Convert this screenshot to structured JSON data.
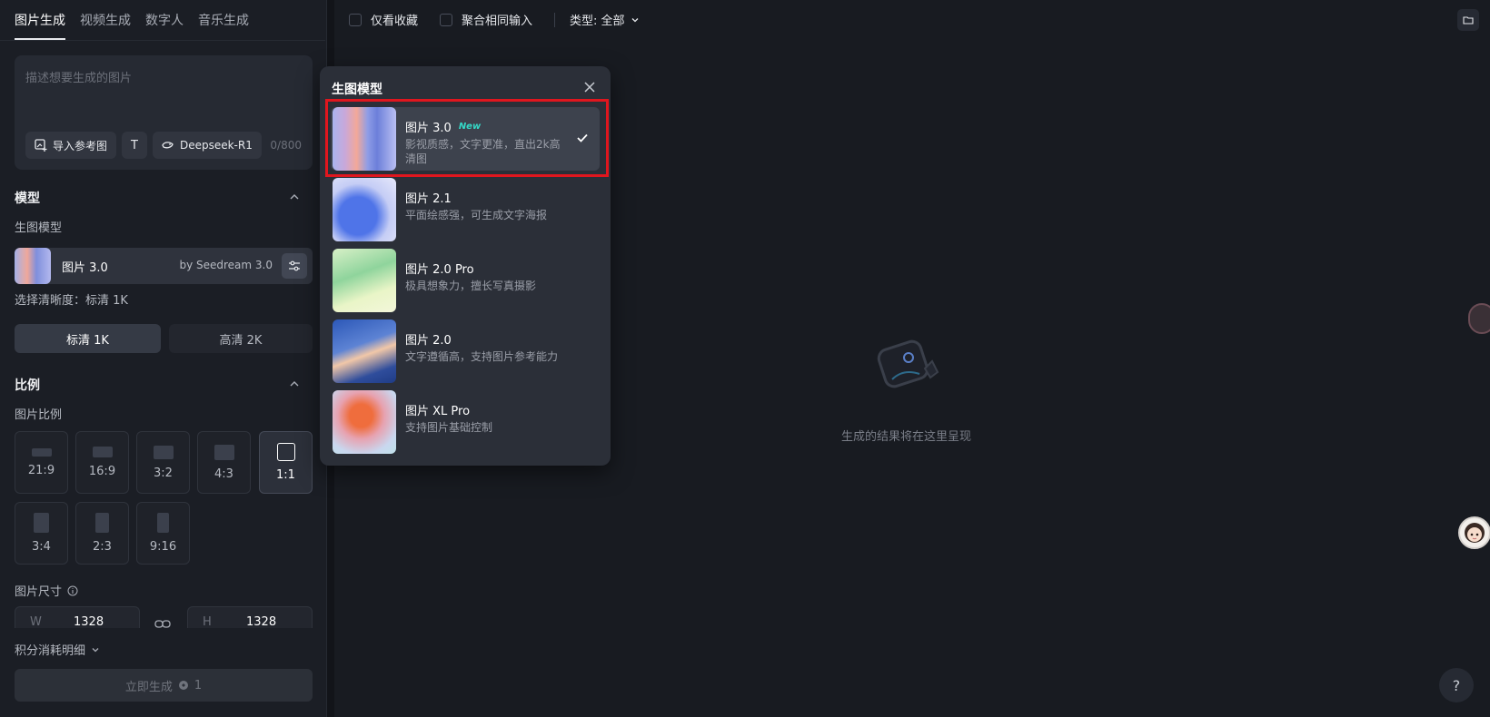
{
  "tabs": [
    "图片生成",
    "视频生成",
    "数字人",
    "音乐生成"
  ],
  "prompt": {
    "placeholder": "描述想要生成的图片",
    "import_label": "导入参考图",
    "text_tool_label": "T",
    "deepseek_label": "Deepseek-R1",
    "counter": "0/800"
  },
  "model_section": {
    "title": "模型",
    "sub_label": "生图模型",
    "current_name": "图片 3.0",
    "current_by": "by Seedream 3.0"
  },
  "resolution": {
    "label": "选择清晰度：标清 1K",
    "options": [
      "标清 1K",
      "高清 2K"
    ],
    "selected": "标清 1K"
  },
  "ratio_section": {
    "title": "比例",
    "sub_label": "图片比例",
    "options": [
      "21:9",
      "16:9",
      "3:2",
      "4:3",
      "1:1",
      "3:4",
      "2:3",
      "9:16"
    ],
    "selected": "1:1"
  },
  "size": {
    "label": "图片尺寸",
    "w_label": "W",
    "w_value": "1328",
    "h_label": "H",
    "h_value": "1328"
  },
  "footer": {
    "credits_label": "积分消耗明细",
    "generate_label": "立即生成",
    "generate_cost": "1"
  },
  "topbar": {
    "favorites_label": "仅看收藏",
    "merge_label": "聚合相同输入",
    "type_label": "类型: 全部"
  },
  "empty_state": {
    "text": "生成的结果将在这里呈现"
  },
  "popup": {
    "title": "生图模型",
    "options": [
      {
        "name": "图片 3.0",
        "badge": "New",
        "desc": "影视质感，文字更准，直出2k高清图",
        "selected": true
      },
      {
        "name": "图片 2.1",
        "badge": "",
        "desc": "平面绘感强，可生成文字海报",
        "selected": false
      },
      {
        "name": "图片 2.0 Pro",
        "badge": "",
        "desc": "极具想象力，擅长写真摄影",
        "selected": false
      },
      {
        "name": "图片 2.0",
        "badge": "",
        "desc": "文字遵循高，支持图片参考能力",
        "selected": false
      },
      {
        "name": "图片 XL Pro",
        "badge": "",
        "desc": "支持图片基础控制",
        "selected": false
      }
    ]
  },
  "help_label": "?",
  "colors": {
    "highlight": "#e0161e",
    "new_badge": "#34d9c7",
    "background": "#121419"
  }
}
